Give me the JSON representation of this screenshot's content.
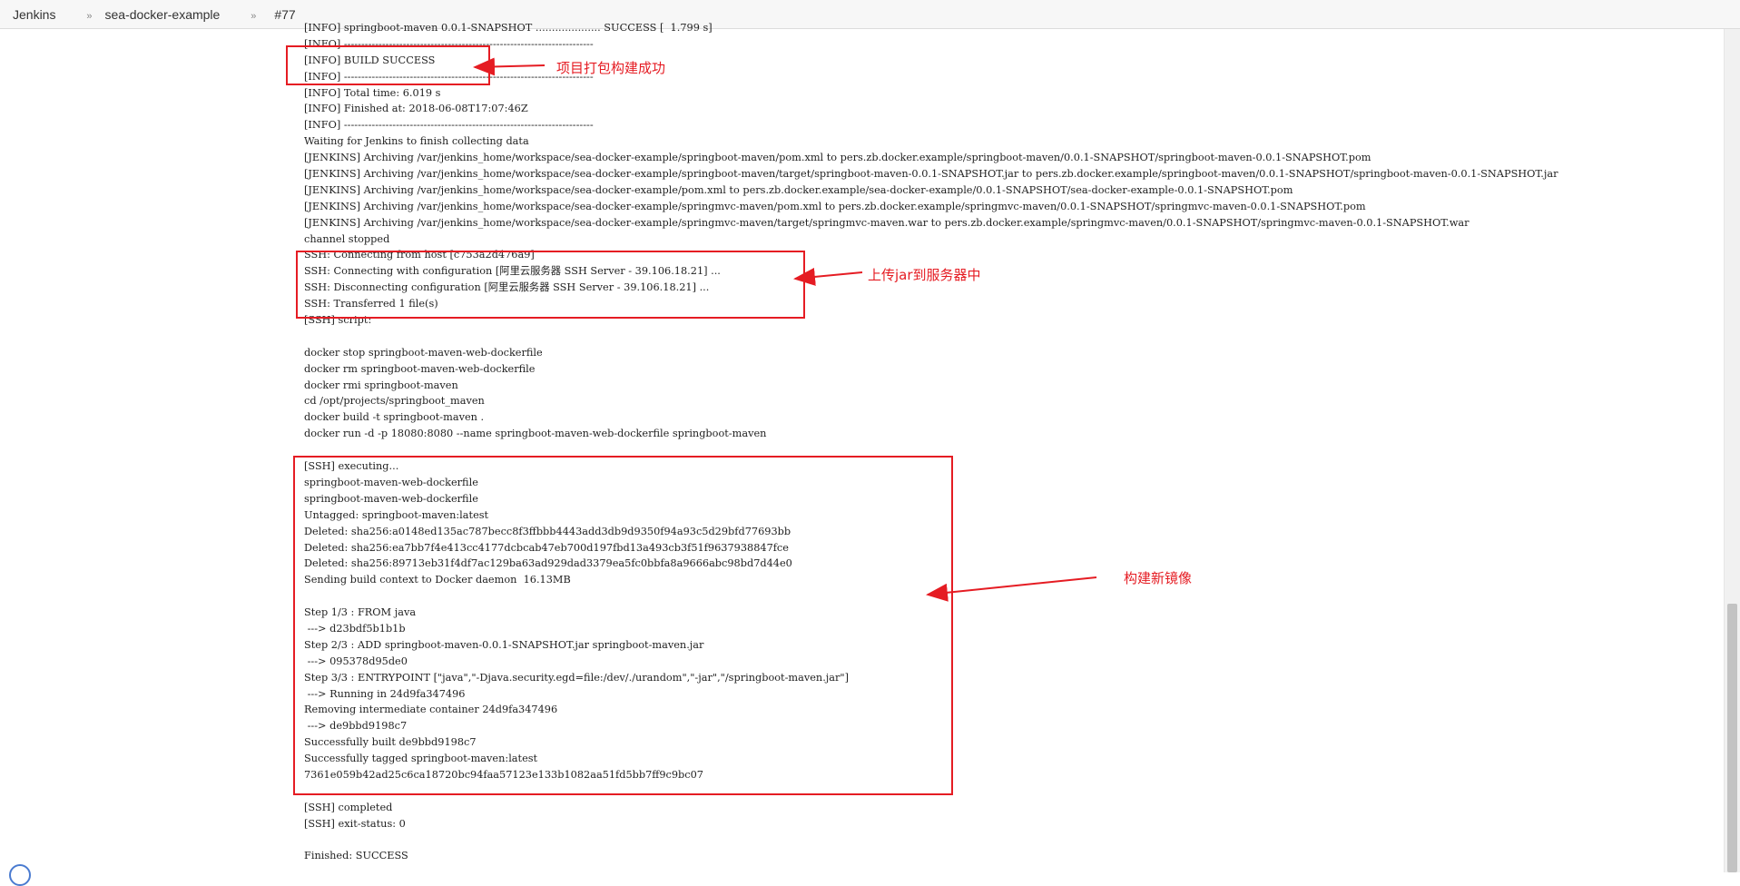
{
  "breadcrumb": {
    "items": [
      "Jenkins",
      "sea-docker-example",
      "#77"
    ],
    "separator": "»"
  },
  "console": {
    "lines": [
      "[INFO] springboot-maven 0.0.1-SNAPSHOT .................... SUCCESS [  1.799 s]",
      "[INFO] ------------------------------------------------------------------------",
      "[INFO] BUILD SUCCESS",
      "[INFO] ------------------------------------------------------------------------",
      "[INFO] Total time: 6.019 s",
      "[INFO] Finished at: 2018-06-08T17:07:46Z",
      "[INFO] ------------------------------------------------------------------------",
      "Waiting for Jenkins to finish collecting data",
      "[JENKINS] Archiving /var/jenkins_home/workspace/sea-docker-example/springboot-maven/pom.xml to pers.zb.docker.example/springboot-maven/0.0.1-SNAPSHOT/springboot-maven-0.0.1-SNAPSHOT.pom",
      "[JENKINS] Archiving /var/jenkins_home/workspace/sea-docker-example/springboot-maven/target/springboot-maven-0.0.1-SNAPSHOT.jar to pers.zb.docker.example/springboot-maven/0.0.1-SNAPSHOT/springboot-maven-0.0.1-SNAPSHOT.jar",
      "[JENKINS] Archiving /var/jenkins_home/workspace/sea-docker-example/pom.xml to pers.zb.docker.example/sea-docker-example/0.0.1-SNAPSHOT/sea-docker-example-0.0.1-SNAPSHOT.pom",
      "[JENKINS] Archiving /var/jenkins_home/workspace/sea-docker-example/springmvc-maven/pom.xml to pers.zb.docker.example/springmvc-maven/0.0.1-SNAPSHOT/springmvc-maven-0.0.1-SNAPSHOT.pom",
      "[JENKINS] Archiving /var/jenkins_home/workspace/sea-docker-example/springmvc-maven/target/springmvc-maven.war to pers.zb.docker.example/springmvc-maven/0.0.1-SNAPSHOT/springmvc-maven-0.0.1-SNAPSHOT.war",
      "channel stopped",
      "SSH: Connecting from host [c753a2d476a9]",
      "SSH: Connecting with configuration [阿里云服务器 SSH Server - 39.106.18.21] ...",
      "SSH: Disconnecting configuration [阿里云服务器 SSH Server - 39.106.18.21] ...",
      "SSH: Transferred 1 file(s)",
      "[SSH] script:",
      "",
      "docker stop springboot-maven-web-dockerfile",
      "docker rm springboot-maven-web-dockerfile",
      "docker rmi springboot-maven",
      "cd /opt/projects/springboot_maven",
      "docker build -t springboot-maven .",
      "docker run -d -p 18080:8080 --name springboot-maven-web-dockerfile springboot-maven",
      "",
      "[SSH] executing...",
      "springboot-maven-web-dockerfile",
      "springboot-maven-web-dockerfile",
      "Untagged: springboot-maven:latest",
      "Deleted: sha256:a0148ed135ac787becc8f3ffbbb4443add3db9d9350f94a93c5d29bfd77693bb",
      "Deleted: sha256:ea7bb7f4e413cc4177dcbcab47eb700d197fbd13a493cb3f51f9637938847fce",
      "Deleted: sha256:89713eb31f4df7ac129ba63ad929dad3379ea5fc0bbfa8a9666abc98bd7d44e0",
      "Sending build context to Docker daemon  16.13MB",
      "",
      "Step 1/3 : FROM java",
      " ---> d23bdf5b1b1b",
      "Step 2/3 : ADD springboot-maven-0.0.1-SNAPSHOT.jar springboot-maven.jar",
      " ---> 095378d95de0",
      "Step 3/3 : ENTRYPOINT [\"java\",\"-Djava.security.egd=file:/dev/./urandom\",\"-jar\",\"/springboot-maven.jar\"]",
      " ---> Running in 24d9fa347496",
      "Removing intermediate container 24d9fa347496",
      " ---> de9bbd9198c7",
      "Successfully built de9bbd9198c7",
      "Successfully tagged springboot-maven:latest",
      "7361e059b42ad25c6ca18720bc94faa57123e133b1082aa51fd5bb7ff9c9bc07",
      "",
      "[SSH] completed",
      "[SSH] exit-status: 0",
      "",
      "Finished: SUCCESS"
    ]
  },
  "annotations": {
    "build_success": "项目打包构建成功",
    "upload_jar": "上传jar到服务器中",
    "build_image": "构建新镜像"
  },
  "colors": {
    "annotation_red": "#e51c23",
    "console_text": "#222222"
  }
}
